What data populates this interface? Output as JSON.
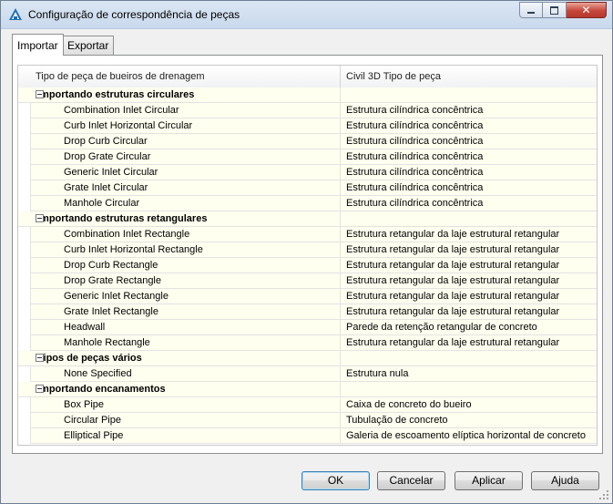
{
  "window": {
    "title": "Configuração de correspondência de peças"
  },
  "tabs": [
    {
      "label": "Importar",
      "active": true
    },
    {
      "label": "Exportar",
      "active": false
    }
  ],
  "grid": {
    "columns": [
      "Tipo de peça de bueiros de drenagem",
      "Civil 3D Tipo de peça"
    ],
    "groups": [
      {
        "label": "Importando estruturas circulares",
        "rows": [
          [
            "Combination Inlet Circular",
            "Estrutura cilíndrica concêntrica"
          ],
          [
            "Curb Inlet Horizontal Circular",
            "Estrutura cilíndrica concêntrica"
          ],
          [
            "Drop Curb Circular",
            "Estrutura cilíndrica concêntrica"
          ],
          [
            "Drop Grate Circular",
            "Estrutura cilíndrica concêntrica"
          ],
          [
            "Generic Inlet Circular",
            "Estrutura cilíndrica concêntrica"
          ],
          [
            "Grate Inlet Circular",
            "Estrutura cilíndrica concêntrica"
          ],
          [
            "Manhole Circular",
            "Estrutura cilíndrica concêntrica"
          ]
        ]
      },
      {
        "label": "Importando estruturas retangulares",
        "rows": [
          [
            "Combination Inlet Rectangle",
            "Estrutura retangular da laje estrutural retangular"
          ],
          [
            "Curb Inlet Horizontal Rectangle",
            "Estrutura retangular da laje estrutural retangular"
          ],
          [
            "Drop Curb Rectangle",
            "Estrutura retangular da laje estrutural retangular"
          ],
          [
            "Drop Grate Rectangle",
            "Estrutura retangular da laje estrutural retangular"
          ],
          [
            "Generic Inlet Rectangle",
            "Estrutura retangular da laje estrutural retangular"
          ],
          [
            "Grate Inlet Rectangle",
            "Estrutura retangular da laje estrutural retangular"
          ],
          [
            "Headwall",
            "Parede da retenção retangular de concreto"
          ],
          [
            "Manhole Rectangle",
            "Estrutura retangular da laje estrutural retangular"
          ]
        ]
      },
      {
        "label": "Tipos de peças vários",
        "rows": [
          [
            "None Specified",
            "Estrutura nula"
          ]
        ]
      },
      {
        "label": "Importando encanamentos",
        "rows": [
          [
            "Box Pipe",
            "Caixa de concreto do bueiro"
          ],
          [
            "Circular Pipe",
            "Tubulação de concreto"
          ],
          [
            "Elliptical Pipe",
            "Galeria de escoamento elíptica horizontal de concreto"
          ]
        ]
      }
    ]
  },
  "buttons": {
    "ok": "OK",
    "cancel": "Cancelar",
    "apply": "Aplicar",
    "help": "Ajuda"
  },
  "colors": {
    "row_background": "#fffff0",
    "accent": "#3c7fb1"
  }
}
